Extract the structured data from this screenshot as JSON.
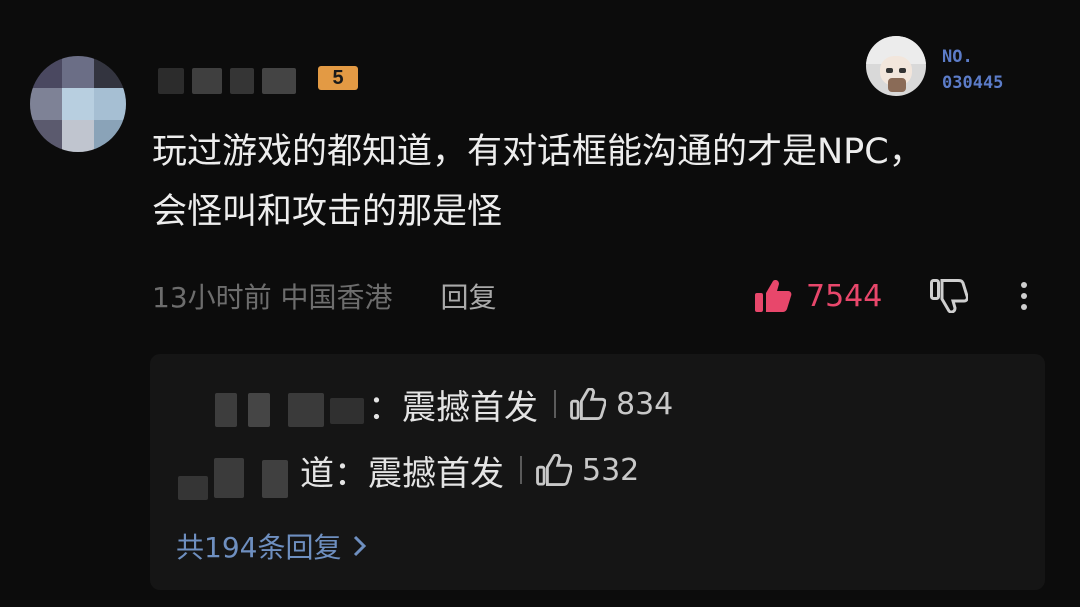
{
  "comment": {
    "level_badge": "5",
    "fan_badge_label": "NO.",
    "fan_badge_number": "030445",
    "text_line1": "玩过游戏的都知道，有对话框能沟通的才是NPC，",
    "text_line2": "会怪叫和攻击的那是怪",
    "time_location": "13小时前 中国香港",
    "reply_label": "回复",
    "like_count": "7544"
  },
  "replies": {
    "items": [
      {
        "name_suffix": "：",
        "text": "震撼首发",
        "likes": "834"
      },
      {
        "name_suffix": "道：",
        "text": "震撼首发",
        "likes": "532"
      }
    ],
    "total_label": "共194条回复"
  },
  "colors": {
    "background": "#0c0c0c",
    "text": "#ededed",
    "like_accent": "#e8476b",
    "link_blue": "#6e8fc0",
    "badge_orange": "#e39a44"
  },
  "icons": {
    "like": "thumbs-up-filled-icon",
    "dislike": "thumbs-down-outline-icon",
    "more": "vertical-dots-icon",
    "reply_like": "thumbs-up-outline-icon",
    "chevron": "chevron-right-icon"
  }
}
